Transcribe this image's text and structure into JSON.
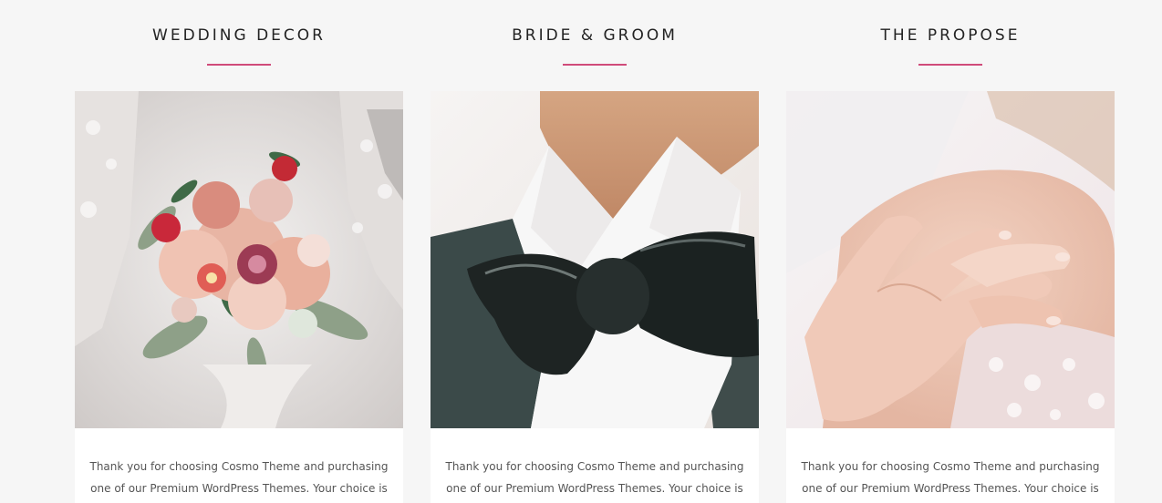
{
  "cards": [
    {
      "title": "WEDDING DECOR",
      "text": "Thank you for choosing Cosmo Theme and purchasing one of our Premium WordPress Themes. Your choice is",
      "image": "bouquet-photo"
    },
    {
      "title": "BRIDE & GROOM",
      "text": "Thank you for choosing Cosmo Theme and purchasing one of our Premium WordPress Themes. Your choice is",
      "image": "bow-tie-photo"
    },
    {
      "title": "THE PROPOSE",
      "text": "Thank you for choosing Cosmo Theme and purchasing one of our Premium WordPress Themes. Your choice is",
      "image": "holding-hands-photo"
    }
  ],
  "colors": {
    "page_background": "#f6f6f6",
    "accent_underline": "#d04b7a",
    "title_text": "#222222",
    "body_text": "#555555"
  }
}
